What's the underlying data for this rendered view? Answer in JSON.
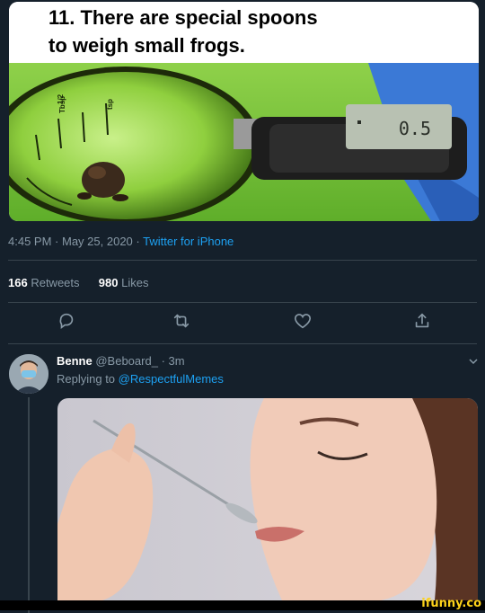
{
  "meme": {
    "caption_line1": "11. There are special spoons",
    "caption_line2": "to weigh small frogs.",
    "scale_reading": "0.5"
  },
  "tweet": {
    "time": "4:45 PM",
    "date": "May 25, 2020",
    "source": "Twitter for iPhone",
    "retweets_count": "166",
    "retweets_label": "Retweets",
    "likes_count": "980",
    "likes_label": "Likes"
  },
  "actions": [
    "reply-icon",
    "retweet-icon",
    "like-icon",
    "share-icon"
  ],
  "reply": {
    "name": "Benne",
    "handle": "@Beboard_",
    "age": "3m",
    "replying_prefix": "Replying to",
    "replying_to": "@RespectfulMemes"
  },
  "watermark": "ifunny.co",
  "colors": {
    "background": "#15202b",
    "link": "#1da1f2",
    "muted": "#8899a6",
    "divider": "#38444d"
  }
}
